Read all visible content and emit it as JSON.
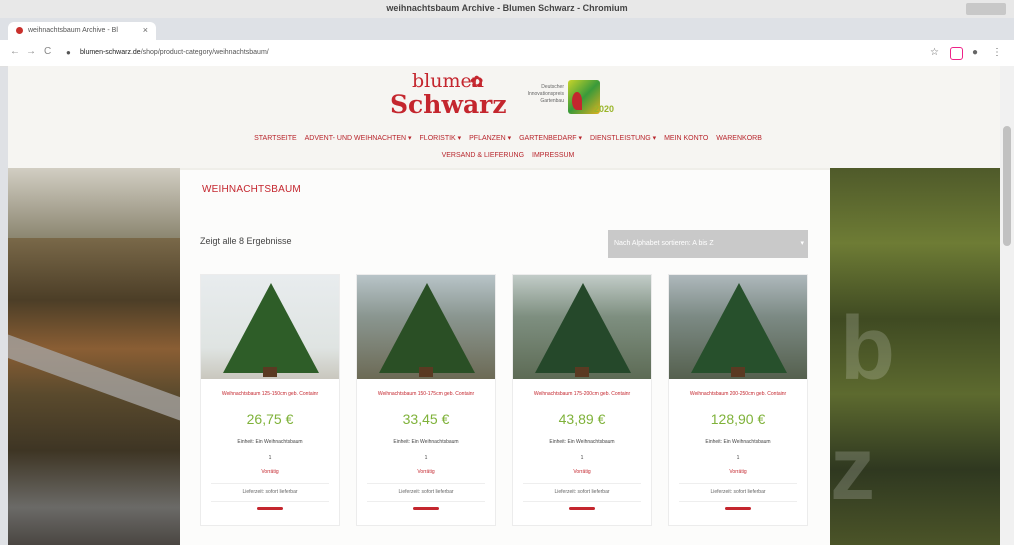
{
  "browser": {
    "window_title": "weihnachtsbaum Archive - Blumen Schwarz - Chromium",
    "tab_label": "weihnachtsbaum Archive - Bl",
    "tab_close": "×",
    "new_tab": "+",
    "url_host": "blumen-schwarz.de",
    "url_path": "/shop/product-category/weihnachtsbaum/",
    "nav_back": "←",
    "nav_forward": "→",
    "nav_reload": "C",
    "lock": "●",
    "star": "☆",
    "profile": "●",
    "menu": "⋮"
  },
  "header": {
    "logo_line1": "blumen",
    "logo_line2": "Schwarz",
    "award_text": "Deutscher Innovationspreis Gartenbau",
    "award_year": "2020"
  },
  "nav": {
    "items": [
      "STARTSEITE",
      "ADVENT- UND WEIHNACHTEN ▾",
      "FLORISTIK ▾",
      "PFLANZEN ▾",
      "GARTENBEDARF ▾",
      "DIENSTLEISTUNG ▾",
      "MEIN KONTO",
      "WARENKORB",
      "VERSAND & LIEFERUNG",
      "IMPRESSUM"
    ]
  },
  "main": {
    "page_title": "WEIHNACHTSBAUM",
    "results_count": "Zeigt alle 8 Ergebnisse",
    "sort_label": "Nach Alphabet sortieren: A bis Z",
    "sort_chevron": "▾"
  },
  "products": [
    {
      "name": "Weihnachtsbaum 125-150cm geb. Containr",
      "price": "26,75 €",
      "unit": "Einheit: Ein Weihnachtsbaum",
      "qty": "1",
      "stock": "Vorrätig",
      "delivery": "Lieferzeit: sofort lieferbar"
    },
    {
      "name": "Weihnachtsbaum 150-175cm geb. Containr",
      "price": "33,45 €",
      "unit": "Einheit: Ein Weihnachtsbaum",
      "qty": "1",
      "stock": "Vorrätig",
      "delivery": "Lieferzeit: sofort lieferbar"
    },
    {
      "name": "Weihnachtsbaum 175-200cm geb. Containr",
      "price": "43,89 €",
      "unit": "Einheit: Ein Weihnachtsbaum",
      "qty": "1",
      "stock": "Vorrätig",
      "delivery": "Lieferzeit: sofort lieferbar"
    },
    {
      "name": "Weihnachtsbaum 200-250cm geb. Containr",
      "price": "128,90 €",
      "unit": "Einheit: Ein Weihnachtsbaum",
      "qty": "1",
      "stock": "Vorrätig",
      "delivery": "Lieferzeit: sofort lieferbar"
    }
  ],
  "colors": {
    "brand_red": "#c4262e",
    "price_green": "#7fb23a"
  }
}
